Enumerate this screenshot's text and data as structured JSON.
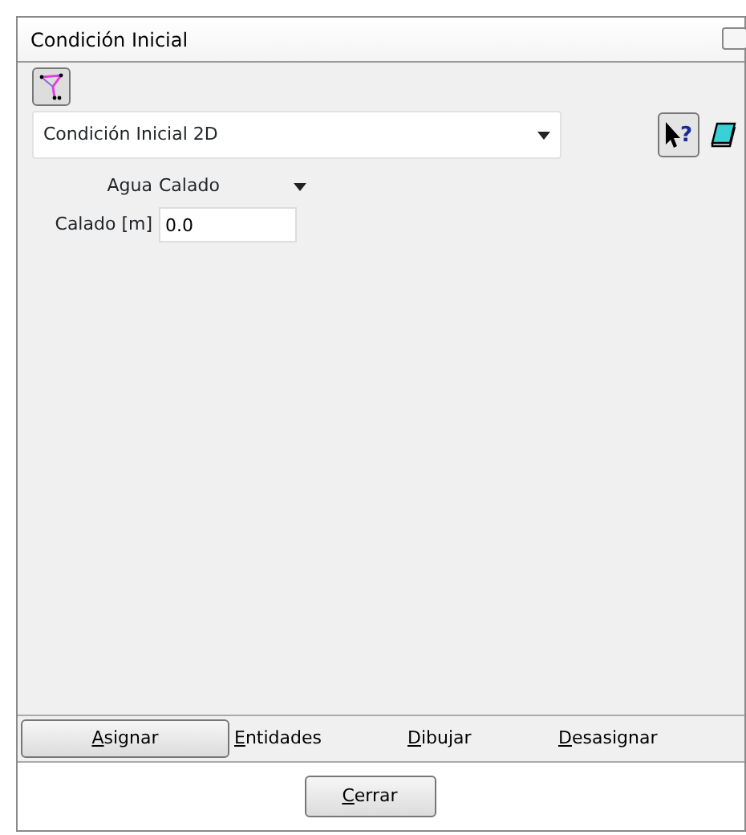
{
  "window": {
    "title": "Condición Inicial"
  },
  "condition": {
    "value": "Condición Inicial 2D"
  },
  "help": {
    "glyph": "?"
  },
  "fields": [
    {
      "kind": "select",
      "label": "Agua",
      "value": "Calado"
    },
    {
      "kind": "input",
      "label": "Calado [m]",
      "value": "0.0"
    }
  ],
  "actions": [
    {
      "label": "Asignar",
      "mnemonic": true,
      "selected": true
    },
    {
      "label": "Entidades",
      "mnemonic": true,
      "selected": false
    },
    {
      "label": "Dibujar",
      "mnemonic": true,
      "selected": false
    },
    {
      "label": "Desasignar",
      "mnemonic": true,
      "selected": false
    }
  ],
  "footer": {
    "button": {
      "label": "Cerrar",
      "mnemonic": true
    }
  }
}
